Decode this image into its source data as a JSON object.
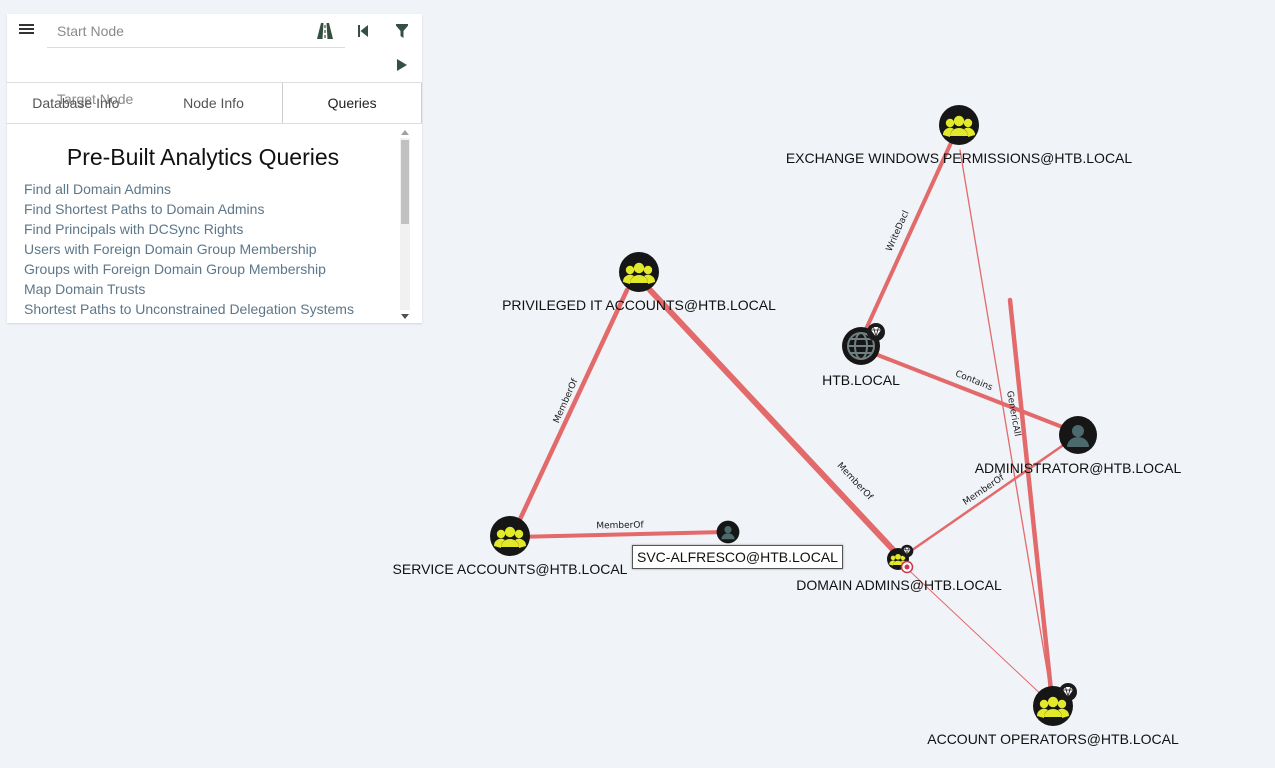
{
  "search": {
    "start_placeholder": "Start Node",
    "target_placeholder": "Target Node"
  },
  "toolbar": {
    "menu_icon": "hamburger-icon",
    "pathfinding_icon": "road-icon",
    "back_icon": "step-back-icon",
    "filter_icon": "filter-icon",
    "play_icon": "play-icon"
  },
  "tabs": [
    {
      "label": "Database Info"
    },
    {
      "label": "Node Info"
    },
    {
      "label": "Queries",
      "active": true
    }
  ],
  "queries": {
    "title": "Pre-Built Analytics Queries",
    "items": [
      "Find all Domain Admins",
      "Find Shortest Paths to Domain Admins",
      "Find Principals with DCSync Rights",
      "Users with Foreign Domain Group Membership",
      "Groups with Foreign Domain Group Membership",
      "Map Domain Trusts",
      "Shortest Paths to Unconstrained Delegation Systems"
    ]
  },
  "graph": {
    "nodes": {
      "exchange": {
        "label": "EXCHANGE WINDOWS PERMISSIONS@HTB.LOCAL",
        "kind": "group"
      },
      "privileged": {
        "label": "PRIVILEGED IT ACCOUNTS@HTB.LOCAL",
        "kind": "group"
      },
      "htb": {
        "label": "HTB.LOCAL",
        "kind": "domain",
        "badge": "gem-icon"
      },
      "admin": {
        "label": "ADMINISTRATOR@HTB.LOCAL",
        "kind": "user"
      },
      "service": {
        "label": "SERVICE ACCOUNTS@HTB.LOCAL",
        "kind": "group"
      },
      "svc": {
        "label": "SVC-ALFRESCO@HTB.LOCAL",
        "kind": "user"
      },
      "domainadmins": {
        "label": "DOMAIN ADMINS@HTB.LOCAL",
        "kind": "group",
        "badges": [
          "gem-icon",
          "target-icon"
        ]
      },
      "accountops": {
        "label": "ACCOUNT OPERATORS@HTB.LOCAL",
        "kind": "group",
        "badge": "gem-icon"
      }
    },
    "edges": {
      "writedacl": "WriteDacl",
      "contains": "Contains",
      "genericall": "GenericAll",
      "memberof_priv_service": "MemberOf",
      "memberof_svc_service": "MemberOf",
      "memberof_priv_da": "MemberOf",
      "memberof_admin_da": "MemberOf"
    },
    "colors": {
      "edge": "#e36a6a",
      "group_fill": "#e2e82a",
      "node_dark": "#1a1a1a",
      "user_fill": "#4c6a6e",
      "background": "#f0f3f8"
    }
  }
}
